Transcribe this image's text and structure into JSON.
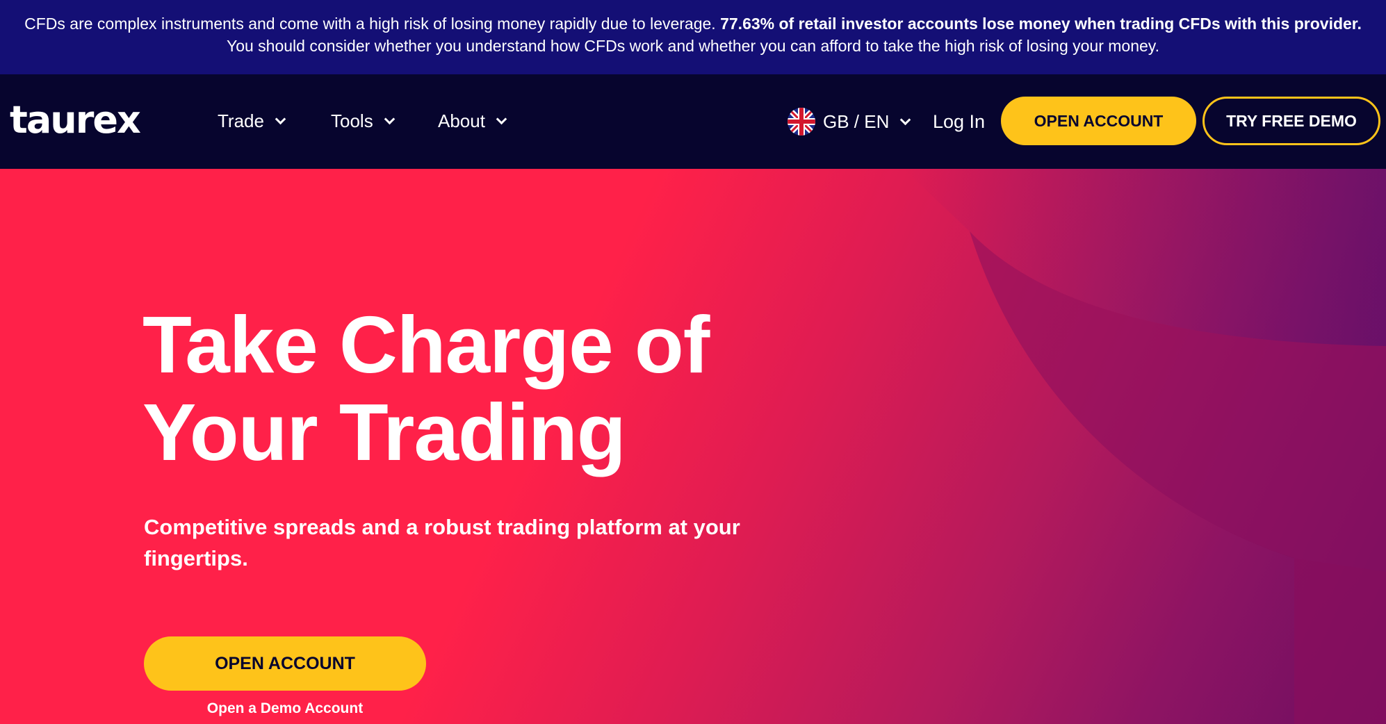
{
  "risk_banner": {
    "text_before": "CFDs are complex instruments and come with a high risk of losing money rapidly due to leverage. ",
    "text_bold": "77.63% of retail investor accounts lose money when trading CFDs with this provider.",
    "text_after": " You should consider whether you understand how CFDs work and whether you can afford to take the high risk of losing your money."
  },
  "header": {
    "logo": "taurex",
    "nav": {
      "trade": "Trade",
      "tools": "Tools",
      "about": "About"
    },
    "language": "GB / EN",
    "login": "Log In",
    "open_account": "OPEN ACCOUNT",
    "try_demo": "TRY FREE DEMO"
  },
  "hero": {
    "title_line1": "Take Charge of",
    "title_line2": "Your Trading",
    "subtitle": "Competitive spreads and a robust trading platform at your fingertips.",
    "open_account": "OPEN ACCOUNT",
    "demo_link": "Open a Demo Account"
  },
  "colors": {
    "banner_bg": "#140f75",
    "nav_bg": "#07052e",
    "hero_red": "#ff2149",
    "accent_yellow": "#fec31a",
    "hero_purple": "#6d0e62"
  },
  "icons": {
    "flag": "uk-flag-icon",
    "chevron": "chevron-down-icon"
  }
}
